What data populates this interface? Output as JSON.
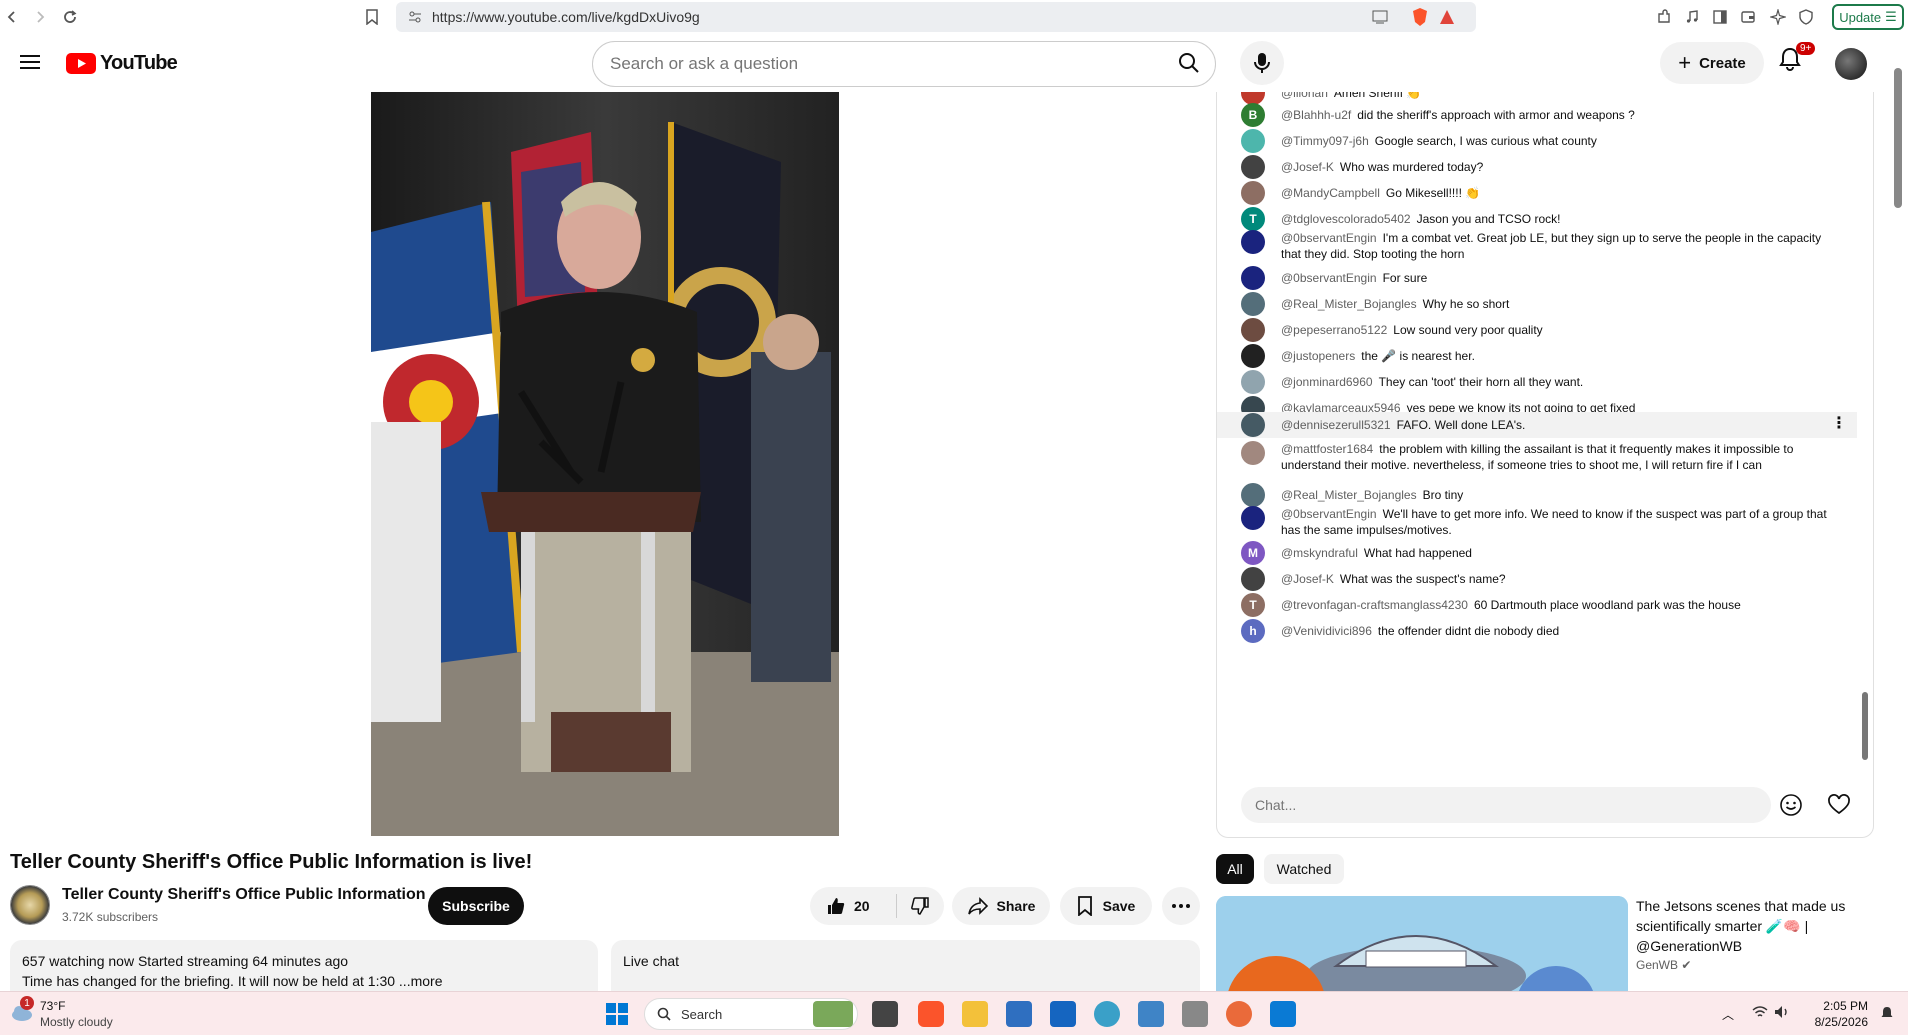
{
  "browser": {
    "url": "https://www.youtube.com/live/kgdDxUivo9g",
    "update_label": "Update"
  },
  "header": {
    "logo_text": "YouTube",
    "search_placeholder": "Search or ask a question",
    "create_label": "Create",
    "notifications_badge": "9+"
  },
  "video": {
    "title": "Teller County Sheriff's Office Public Information is live!",
    "channel_name": "Teller County Sheriff's Office Public Information",
    "subscribers": "3.72K subscribers",
    "subscribe_label": "Subscribe",
    "like_count": "20",
    "share_label": "Share",
    "save_label": "Save",
    "watching": "657 watching now  Started streaming 64 minutes ago",
    "description": "Time has changed for the briefing. It will now be held at 1:30 ...more",
    "live_chat_label": "Live chat"
  },
  "chat": {
    "messages": [
      {
        "author": "@lilohan",
        "text": "Amen Sheriff 👏",
        "avatar": "",
        "color": "#c0392b"
      },
      {
        "author": "@Blahhh-u2f",
        "text": "did the sheriff's approach with armor and weapons ?",
        "avatar": "B",
        "color": "#2e7d32"
      },
      {
        "author": "@Timmy097-j6h",
        "text": "Google search, I was curious what county",
        "avatar": "",
        "color": "#4db6ac"
      },
      {
        "author": "@Josef-K",
        "text": "Who was murdered today?",
        "avatar": "",
        "color": "#424242"
      },
      {
        "author": "@MandyCampbell",
        "text": "Go Mikesell!!!! 👏",
        "avatar": "",
        "color": "#8d6e63"
      },
      {
        "author": "@tdglovescolorado5402",
        "text": "Jason you and TCSO rock!",
        "avatar": "T",
        "color": "#00897b"
      },
      {
        "author": "@0bservantEngin",
        "text": "I'm a combat vet. Great job LE, but they sign up to serve the people in the capacity that they did. Stop tooting the horn",
        "avatar": "",
        "color": "#1a237e"
      },
      {
        "author": "@0bservantEngin",
        "text": "For sure",
        "avatar": "",
        "color": "#1a237e"
      },
      {
        "author": "@Real_Mister_Bojangles",
        "text": "Why he so short",
        "avatar": "",
        "color": "#546e7a"
      },
      {
        "author": "@pepeserrano5122",
        "text": "Low sound very poor quality",
        "avatar": "",
        "color": "#6d4c41"
      },
      {
        "author": "@justopeners",
        "text": "the 🎤 is nearest her.",
        "avatar": "",
        "color": "#212121"
      },
      {
        "author": "@jonminard6960",
        "text": "They can 'toot' their horn all they want.",
        "avatar": "",
        "color": "#90a4ae"
      },
      {
        "author": "@kaylamarceaux5946",
        "text": "yes pepe we know its not going to get fixed",
        "avatar": "",
        "color": "#37474f"
      },
      {
        "author": "@dennisezerull5321",
        "text": "FAFO. Well done LEA's.",
        "avatar": "",
        "color": "#455a64"
      },
      {
        "author": "@mattfoster1684",
        "text": "the problem with killing the assailant is that it frequently makes it impossible to understand their motive. nevertheless, if someone tries to shoot me, I will return fire if I can",
        "avatar": "",
        "color": "#a1887f"
      },
      {
        "author": "@Real_Mister_Bojangles",
        "text": "Bro tiny",
        "avatar": "",
        "color": "#546e7a"
      },
      {
        "author": "@0bservantEngin",
        "text": "We'll have to get more info. We need to know if the suspect was part of a group that has the same impulses/motives.",
        "avatar": "",
        "color": "#1a237e"
      },
      {
        "author": "@mskyndraful",
        "text": "What had happened",
        "avatar": "M",
        "color": "#7e57c2"
      },
      {
        "author": "@Josef-K",
        "text": "What was the suspect's name?",
        "avatar": "",
        "color": "#424242"
      },
      {
        "author": "@trevonfagan-craftsmanglass4230",
        "text": "60 Dartmouth place woodland park was the house",
        "avatar": "T",
        "color": "#8d6e63"
      },
      {
        "author": "@Venividivici896",
        "text": "the offender didnt die nobody died",
        "avatar": "h",
        "color": "#5c6bc0"
      }
    ],
    "input_placeholder": "Chat..."
  },
  "recommendations": {
    "chips": [
      "All",
      "Watched"
    ],
    "title": "The Jetsons scenes that made us scientifically smarter 🧪🧠 | @GenerationWB",
    "channel": "GenWB"
  },
  "taskbar": {
    "temp": "73°F",
    "weather": "Mostly cloudy",
    "weather_badge": "1",
    "search_label": "Search",
    "time": "2:05 PM",
    "date": "8/25/2026"
  }
}
